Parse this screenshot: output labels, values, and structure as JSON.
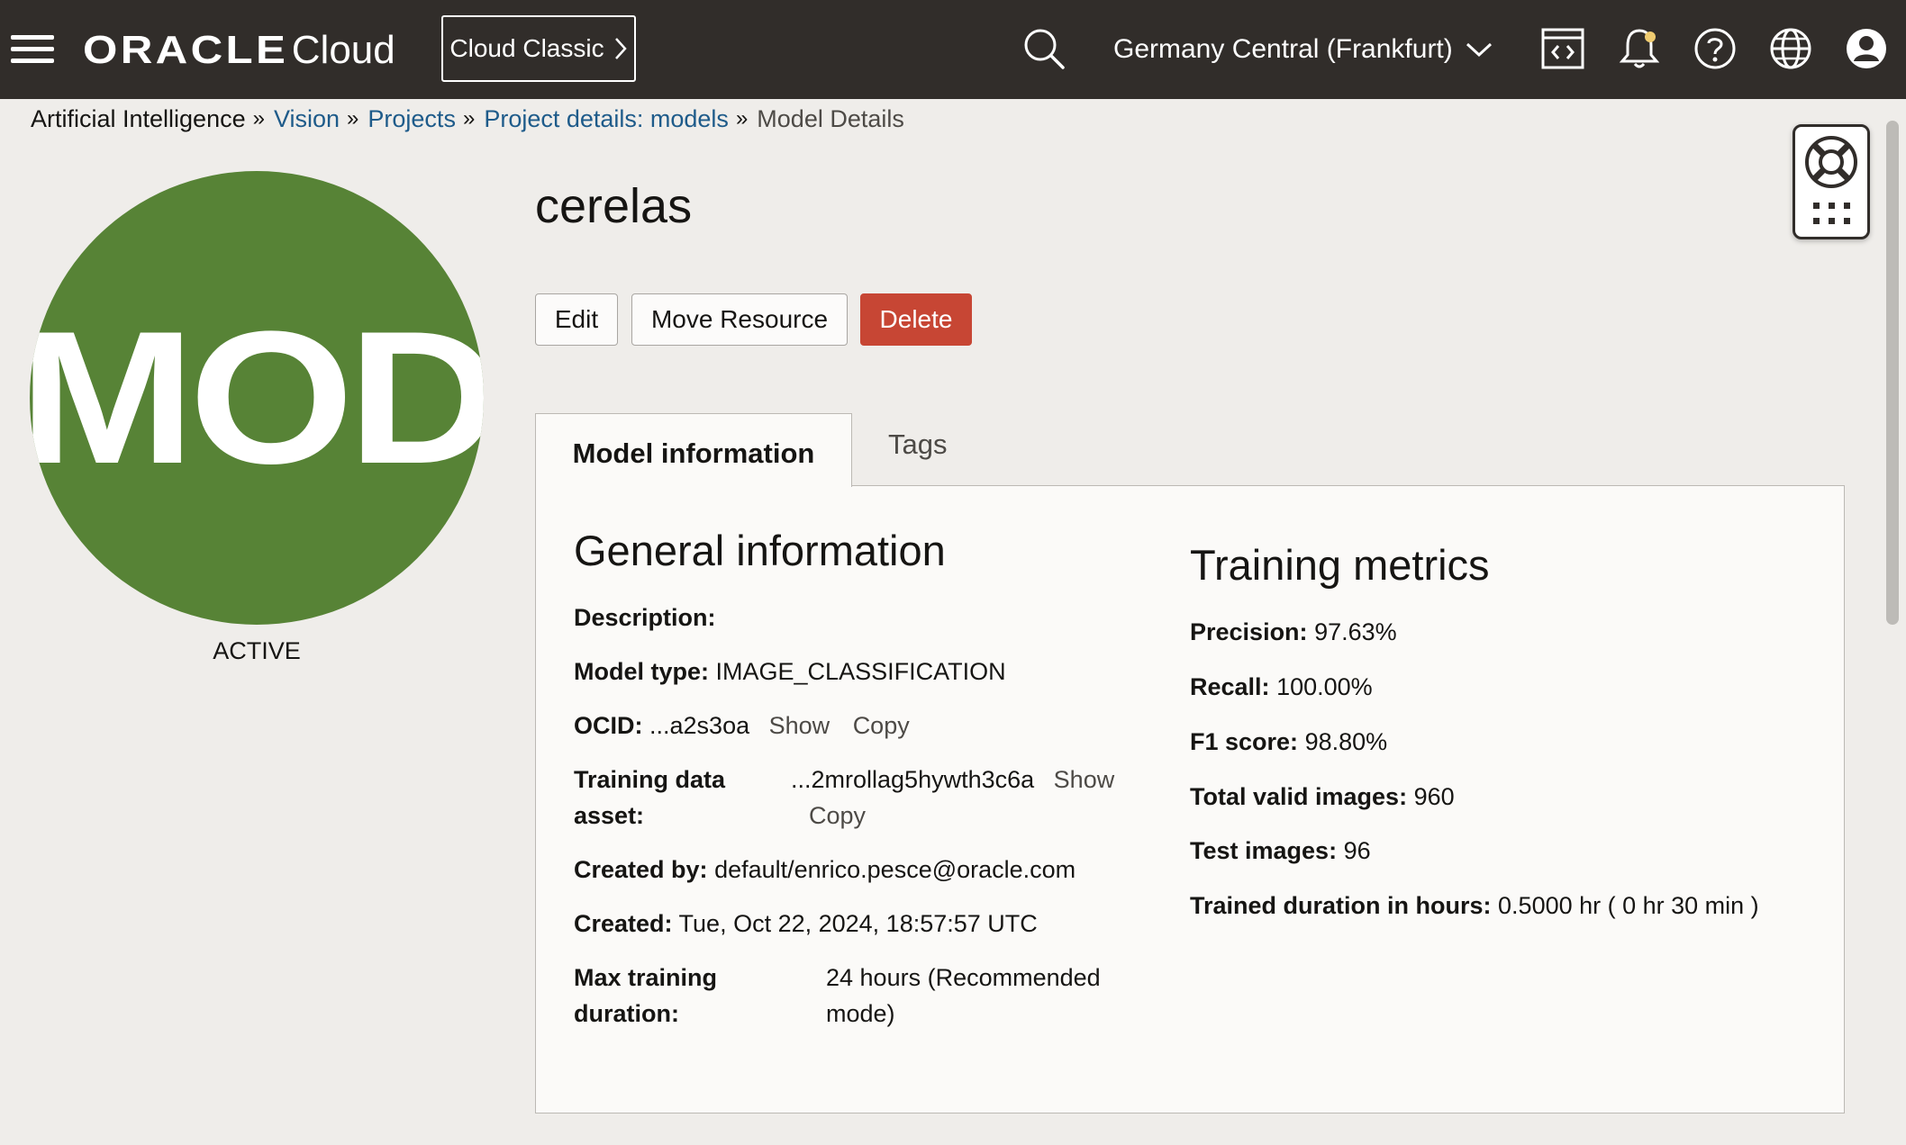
{
  "header": {
    "logo_oracle": "ORACLE",
    "logo_cloud": "Cloud",
    "cloud_classic_label": "Cloud Classic",
    "region_label": "Germany Central (Frankfurt)"
  },
  "breadcrumb": {
    "items": [
      {
        "label": "Artificial Intelligence",
        "link": false
      },
      {
        "label": "Vision",
        "link": true
      },
      {
        "label": "Projects",
        "link": true
      },
      {
        "label": "Project details: models",
        "link": true
      },
      {
        "label": "Model Details",
        "link": false
      }
    ],
    "separator": "»"
  },
  "avatar": {
    "text": "MOD",
    "status": "ACTIVE",
    "color": "#578336"
  },
  "model": {
    "name": "cerelas"
  },
  "actions": {
    "edit": "Edit",
    "move": "Move Resource",
    "delete": "Delete"
  },
  "tabs": [
    {
      "label": "Model information",
      "active": true
    },
    {
      "label": "Tags",
      "active": false
    }
  ],
  "general": {
    "title": "General information",
    "description_label": "Description:",
    "model_type_label": "Model type:",
    "model_type_value": "IMAGE_CLASSIFICATION",
    "ocid_label": "OCID:",
    "ocid_value": "...a2s3oa",
    "show": "Show",
    "copy": "Copy",
    "training_asset_label_1": "Training data",
    "training_asset_label_2": "asset:",
    "training_asset_value": "...2mrollag5hywth3c6a",
    "created_by_label": "Created by:",
    "created_by_value": "default/enrico.pesce@oracle.com",
    "created_label": "Created:",
    "created_value": "Tue, Oct 22, 2024, 18:57:57 UTC",
    "max_training_label_1": "Max training",
    "max_training_label_2": "duration:",
    "max_training_value_1": "24 hours (Recommended",
    "max_training_value_2": "mode)"
  },
  "metrics": {
    "title": "Training metrics",
    "precision_label": "Precision:",
    "precision_value": "97.63%",
    "recall_label": "Recall:",
    "recall_value": "100.00%",
    "f1_label": "F1 score:",
    "f1_value": "98.80%",
    "total_images_label": "Total valid images:",
    "total_images_value": "960",
    "test_images_label": "Test images:",
    "test_images_value": "96",
    "duration_label": "Trained duration in hours:",
    "duration_value": "0.5000 hr ( 0 hr 30 min )"
  },
  "icons": {
    "menu": "hamburger-menu-icon",
    "search": "search-icon",
    "region": "chevron-down-icon",
    "code": "code-editor-icon",
    "notifications": "bell-icon",
    "help": "help-icon",
    "language": "globe-icon",
    "profile": "user-profile-icon",
    "support": "lifebuoy-icon",
    "apps": "grid-icon"
  },
  "colors": {
    "topbar": "#312d2a",
    "link": "#1e5b8a",
    "delete": "#c74634",
    "notification_dot": "#f0cc71"
  }
}
